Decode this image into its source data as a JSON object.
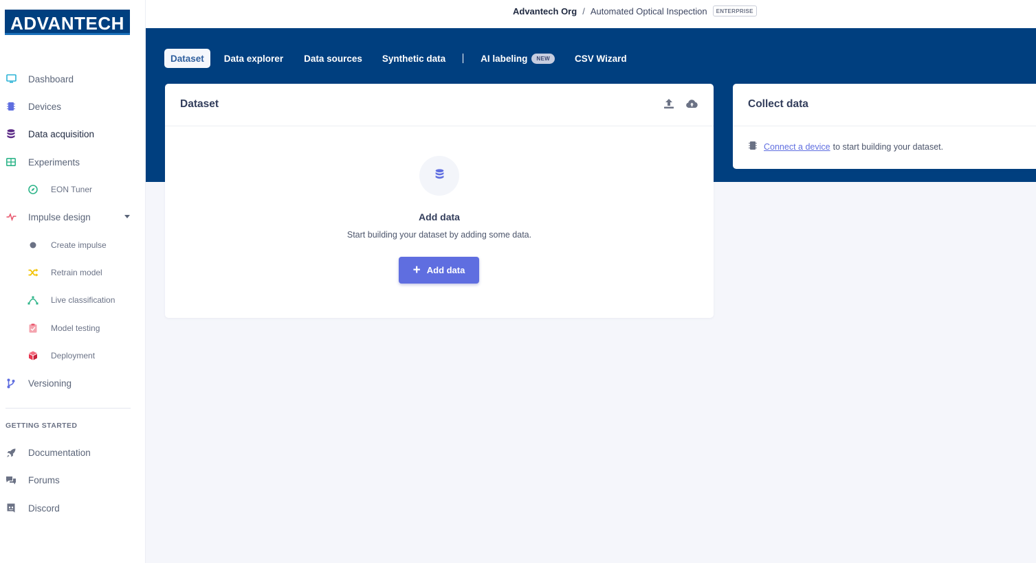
{
  "brand": {
    "logo_text": "ADVANTECH"
  },
  "sidebar": {
    "items": [
      {
        "label": "Dashboard",
        "icon": "monitor-icon"
      },
      {
        "label": "Devices",
        "icon": "chip-icon"
      },
      {
        "label": "Data acquisition",
        "icon": "database-icon",
        "active": true
      },
      {
        "label": "Experiments",
        "icon": "table-icon"
      },
      {
        "label": "EON Tuner",
        "icon": "compass-icon"
      },
      {
        "label": "Impulse design",
        "icon": "pulse-icon"
      },
      {
        "label": "Create impulse",
        "icon": "dot-icon"
      },
      {
        "label": "Retrain model",
        "icon": "shuffle-icon"
      },
      {
        "label": "Live classification",
        "icon": "bezier-icon"
      },
      {
        "label": "Model testing",
        "icon": "clipboard-check-icon"
      },
      {
        "label": "Deployment",
        "icon": "cube-icon"
      },
      {
        "label": "Versioning",
        "icon": "branch-icon"
      }
    ],
    "section_title": "GETTING STARTED",
    "help_items": [
      {
        "label": "Documentation",
        "icon": "rocket-icon"
      },
      {
        "label": "Forums",
        "icon": "comments-icon"
      },
      {
        "label": "Discord",
        "icon": "discord-icon"
      }
    ]
  },
  "breadcrumb": {
    "org": "Advantech Org",
    "separator": "/",
    "project": "Automated Optical Inspection",
    "badge": "ENTERPRISE"
  },
  "tabs": [
    {
      "label": "Dataset",
      "active": true
    },
    {
      "label": "Data explorer"
    },
    {
      "label": "Data sources"
    },
    {
      "label": "Synthetic data"
    },
    {
      "label": "AI labeling",
      "badge": "NEW"
    },
    {
      "label": "CSV Wizard"
    }
  ],
  "dataset_card": {
    "title": "Dataset",
    "empty_title": "Add data",
    "empty_subtitle": "Start building your dataset by adding some data.",
    "add_button": "Add data"
  },
  "collect_card": {
    "title": "Collect data",
    "link_text": "Connect a device",
    "trailing_text": "to start building your dataset."
  },
  "colors": {
    "brand_blue": "#003f7f",
    "accent": "#5f6ee0",
    "page_bg": "#f5f6fb"
  }
}
